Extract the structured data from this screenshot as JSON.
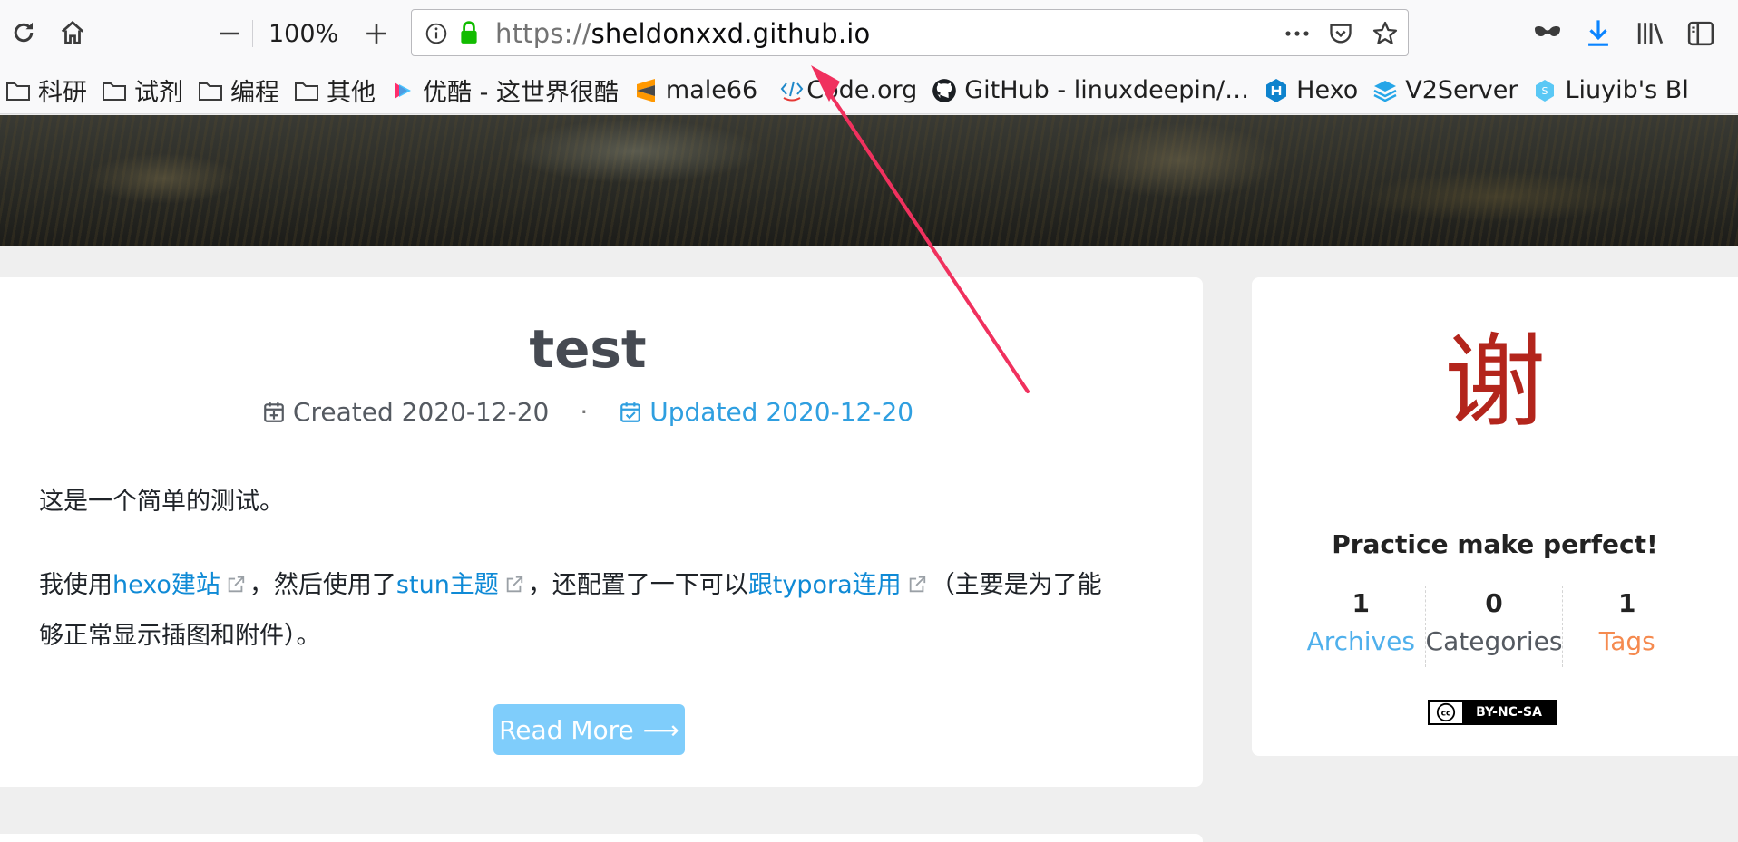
{
  "toolbar": {
    "zoom_level": "100%",
    "url_scheme": "https://",
    "url_host": "sheldonxxd.github.io"
  },
  "bookmarks": [
    {
      "label": "科研",
      "icon": "folder-icon"
    },
    {
      "label": "试剂",
      "icon": "folder-icon"
    },
    {
      "label": "编程",
      "icon": "folder-icon"
    },
    {
      "label": "其他",
      "icon": "folder-icon"
    },
    {
      "label": "优酷 - 这世界很酷",
      "icon": "youku-icon"
    },
    {
      "label": "male66",
      "icon": "sublime-icon"
    },
    {
      "label": "Code.org",
      "icon": "code-icon"
    },
    {
      "label": "GitHub - linuxdeepin/…",
      "icon": "github-icon"
    },
    {
      "label": "Hexo",
      "icon": "hexo-icon"
    },
    {
      "label": "V2Server",
      "icon": "layers-icon"
    },
    {
      "label": "Liuyib's Bl",
      "icon": "hex-icon"
    }
  ],
  "post": {
    "title": "test",
    "created": "Created 2020-12-20",
    "meta_separator": "·",
    "updated": "Updated 2020-12-20",
    "para1": "这是一个简单的测试。",
    "para2_prefix": "我使用",
    "link_hexo": "hexo建站",
    "para2_mid1": "，然后使用了",
    "link_stun": "stun主题",
    "para2_mid2": "，还配置了一下可以",
    "link_typora": "跟typora连用",
    "para2_suffix": "（主要是为了能",
    "para2_line2": "够正常显示插图和附件）。",
    "read_more": "Read More",
    "read_more_arrow": "⟶"
  },
  "sidebar": {
    "avatar_text": "谢",
    "motto": "Practice make perfect!",
    "stats": [
      {
        "num": "1",
        "label": "Archives",
        "color": "#4fb0ec"
      },
      {
        "num": "0",
        "label": "Categories",
        "color": "#555a61"
      },
      {
        "num": "1",
        "label": "Tags",
        "color": "#f58a4f"
      }
    ],
    "license": "BY-NC-SA"
  },
  "colors": {
    "link": "#0f8ad6",
    "accent_blue": "#2f9fe0",
    "read_more_bg": "#7fcdfb",
    "annotation_arrow": "#f0315e"
  }
}
